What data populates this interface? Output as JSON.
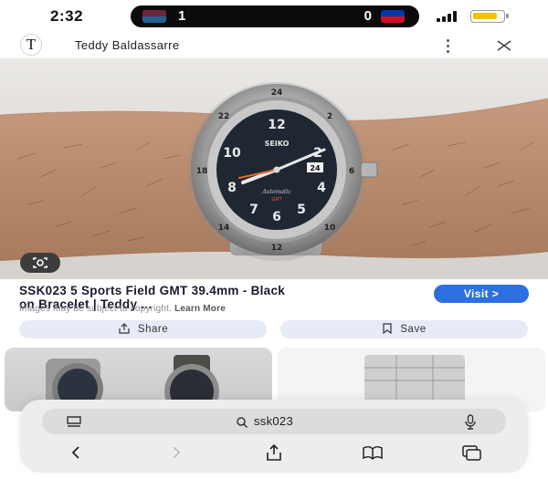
{
  "status_bar": {
    "time": "2:32",
    "live_activity": {
      "home_score": "1",
      "away_score": "0"
    },
    "battery_level_fraction": 0.85,
    "battery_color": "#f2c300"
  },
  "header": {
    "site_logo": "T",
    "site_name": "Teddy Baldassarre"
  },
  "result": {
    "title_line1": "SSK023 5 Sports Field GMT 39.4mm - Black",
    "title_line2": "on Bracelet | Teddy ...",
    "visit_label": "Visit >",
    "copyright_prefix": "Images may be subject to copyright.",
    "learn_more": "Learn More",
    "share_label": "Share",
    "save_label": "Save",
    "accent_color": "#2e6fe0"
  },
  "watch": {
    "brand": "SEIKO",
    "model_text": "Automatic",
    "sub_text": "GMT",
    "date": "24"
  },
  "search": {
    "query": "ssk023"
  }
}
